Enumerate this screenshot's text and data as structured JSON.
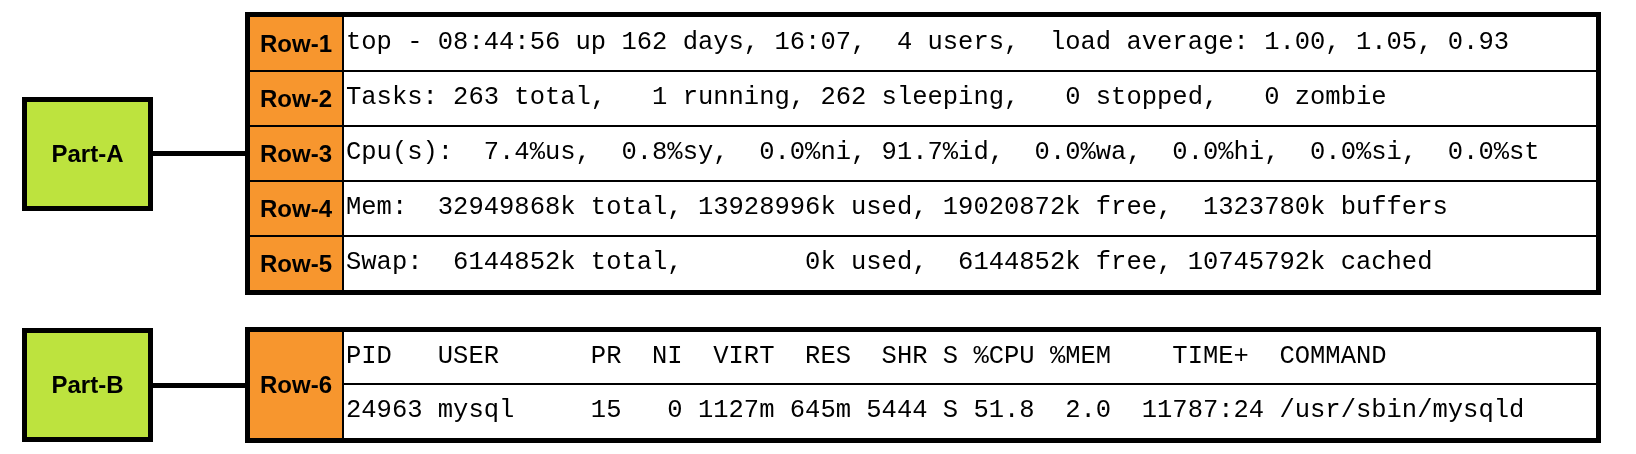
{
  "parts": [
    {
      "label": "Part-A",
      "rows": [
        {
          "label": "Row-1",
          "lines": [
            "top - 08:44:56 up 162 days, 16:07,  4 users,  load average: 1.00, 1.05, 0.93"
          ]
        },
        {
          "label": "Row-2",
          "lines": [
            "Tasks: 263 total,   1 running, 262 sleeping,   0 stopped,   0 zombie"
          ]
        },
        {
          "label": "Row-3",
          "lines": [
            "Cpu(s):  7.4%us,  0.8%sy,  0.0%ni, 91.7%id,  0.0%wa,  0.0%hi,  0.0%si,  0.0%st"
          ]
        },
        {
          "label": "Row-4",
          "lines": [
            "Mem:  32949868k total, 13928996k used, 19020872k free,  1323780k buffers"
          ]
        },
        {
          "label": "Row-5",
          "lines": [
            "Swap:  6144852k total,        0k used,  6144852k free, 10745792k cached"
          ]
        }
      ]
    },
    {
      "label": "Part-B",
      "rows": [
        {
          "label": "Row-6",
          "lines": [
            "PID   USER      PR  NI  VIRT  RES  SHR S %CPU %MEM    TIME+  COMMAND",
            "24963 mysql     15   0 1127m 645m 5444 S 51.8  2.0  11787:24 /usr/sbin/mysqld"
          ]
        }
      ]
    }
  ]
}
